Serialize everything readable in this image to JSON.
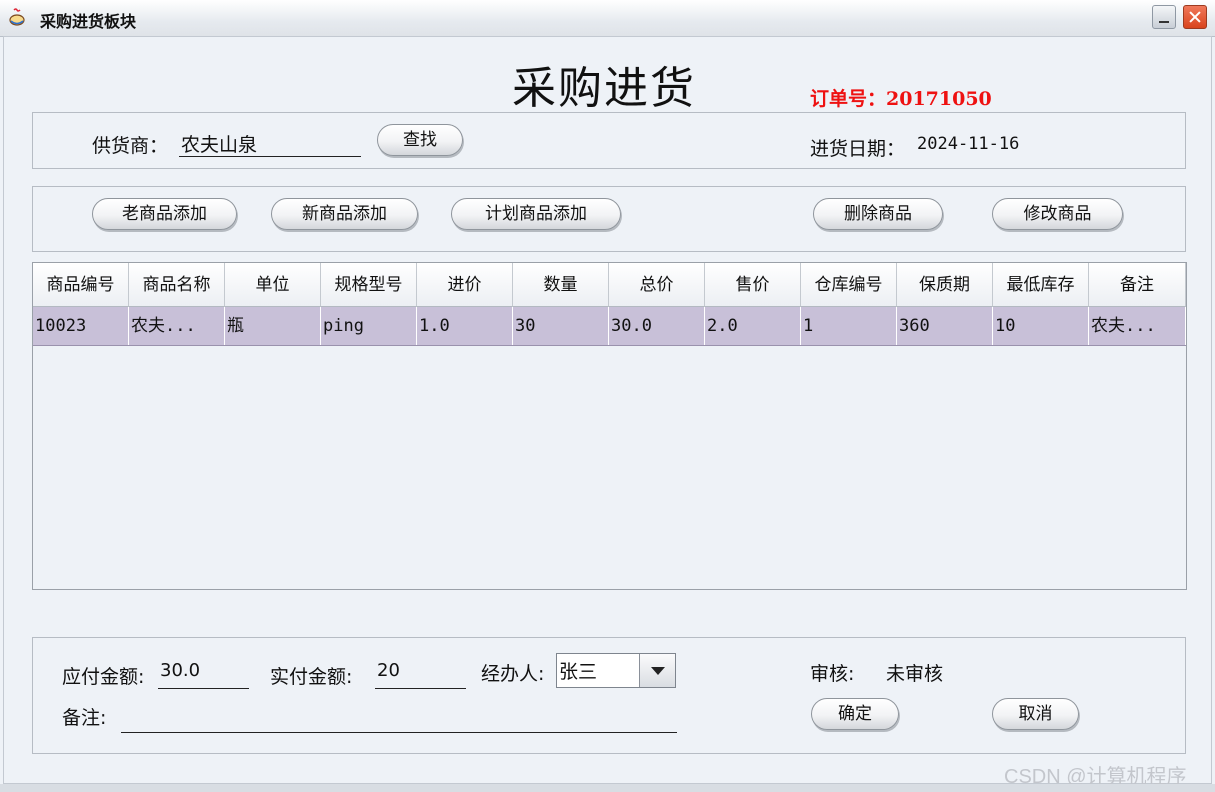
{
  "window": {
    "title": "采购进货板块"
  },
  "header": {
    "title": "采购进货",
    "order_no": "订单号：20171050"
  },
  "supplier_panel": {
    "supplier_label": "供货商：",
    "supplier_value": "农夫山泉",
    "search_button": "查找",
    "date_label": "进货日期：",
    "date_value": "2024-11-16"
  },
  "toolbar": {
    "add_old": "老商品添加",
    "add_new": "新商品添加",
    "add_plan": "计划商品添加",
    "delete": "删除商品",
    "edit": "修改商品"
  },
  "table": {
    "columns": [
      "商品编号",
      "商品名称",
      "单位",
      "规格型号",
      "进价",
      "数量",
      "总价",
      "售价",
      "仓库编号",
      "保质期",
      "最低库存",
      "备注"
    ],
    "rows": [
      [
        "10023",
        "农夫...",
        "瓶",
        "ping",
        "1.0",
        "30",
        "30.0",
        "2.0",
        "1",
        "360",
        "10",
        "农夫..."
      ]
    ]
  },
  "footer": {
    "payable_label": "应付金额:",
    "payable_value": "30.0",
    "paid_label": "实付金额:",
    "paid_value": "20",
    "handler_label": "经办人:",
    "handler_value": "张三",
    "review_label": "审核:",
    "review_value": "未审核",
    "note_label": "备注:",
    "note_value": "",
    "confirm_button": "确定",
    "cancel_button": "取消"
  },
  "watermark": "CSDN @计算机程序",
  "colors": {
    "order_red": "#ee1111",
    "row_selected": "#c8c0d8",
    "background": "#eef2f7"
  },
  "icons": {
    "app": "app-icon",
    "minimize": "minimize-icon",
    "close": "close-icon",
    "dropdown": "chevron-down-icon"
  }
}
